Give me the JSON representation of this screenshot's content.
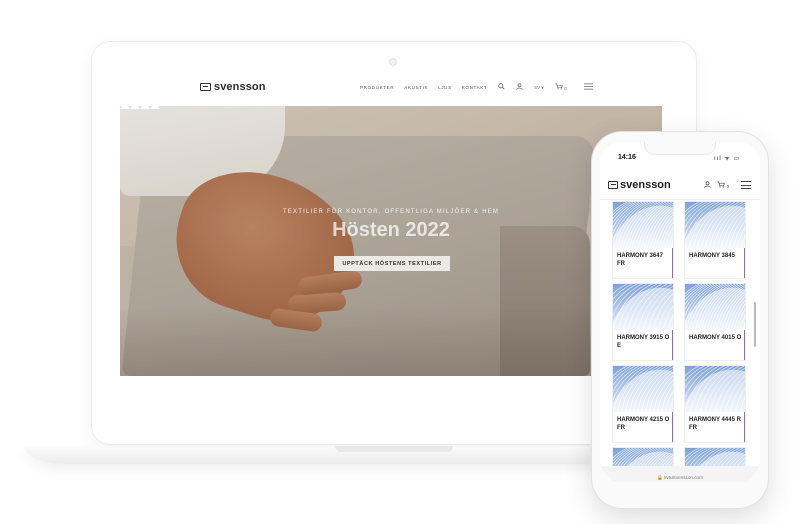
{
  "laptop": {
    "site": {
      "logo": "svensson",
      "nav": [
        "PRODUKTER",
        "AKUSTIK",
        "LJUS",
        "KONTAKT"
      ],
      "icons": [
        "search-icon",
        "user-icon",
        "language-selector",
        "cart-icon",
        "menu-icon"
      ],
      "language": "SV",
      "cart_count": "0"
    },
    "hero": {
      "kicker": "TEXTILIER FÖR KONTOR, OFFENTLIGA MILJÖER & HEM",
      "title": "Hösten 2022",
      "cta": "UPPTÄCK HÖSTENS TEXTILIER"
    }
  },
  "phone": {
    "status": {
      "time": "14:16",
      "signal": "ııl ᯤ ▭"
    },
    "header": {
      "logo": "svensson",
      "cart_count": "0"
    },
    "products": [
      {
        "name": "HARMONY 3647 FR"
      },
      {
        "name": "HARMONY 3845"
      },
      {
        "name": "HARMONY 3915 O E"
      },
      {
        "name": "HARMONY 4015 O"
      },
      {
        "name": "HARMONY 4215 O FR"
      },
      {
        "name": "HARMONY 4445 R FR"
      },
      {
        "name": ""
      },
      {
        "name": ""
      }
    ],
    "url": "🔒 kvtulsvensson.com"
  },
  "colors": {
    "accent": "#8a6fb3",
    "cta_bg": "#ece8e3",
    "fabric_blue": "#7fa2d6"
  }
}
